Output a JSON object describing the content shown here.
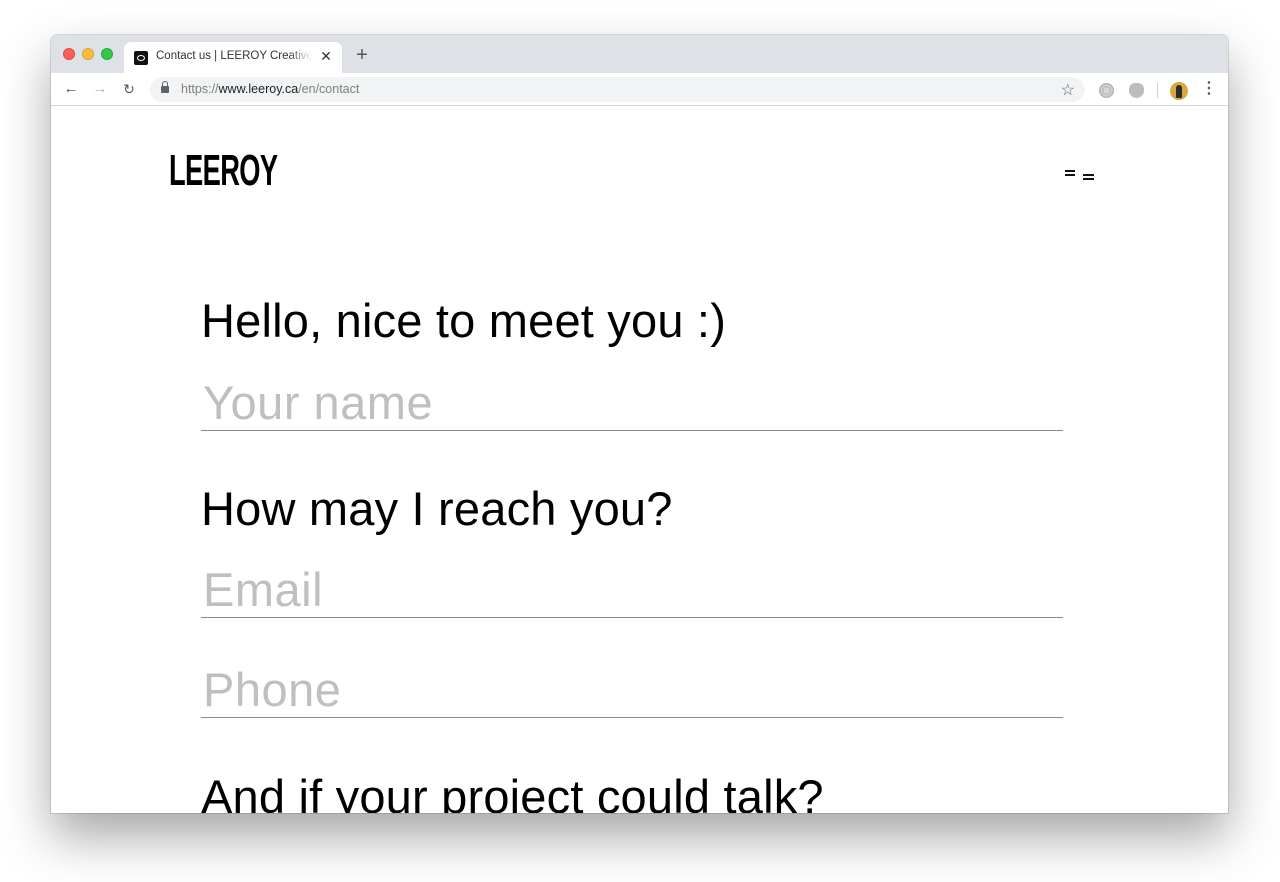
{
  "browser": {
    "tab": {
      "title": "Contact us | LEEROY Creative Agency",
      "close_glyph": "✕"
    },
    "new_tab_glyph": "+",
    "nav": {
      "back_glyph": "←",
      "forward_glyph": "→",
      "reload_glyph": "↻"
    },
    "url": {
      "scheme": "https://",
      "host": "www.leeroy.ca",
      "path": "/en/contact"
    },
    "star_glyph": "☆",
    "menu_glyph": "⋮"
  },
  "site": {
    "logo": "LEEROY"
  },
  "form": {
    "q1_heading": "Hello, nice to meet you :)",
    "name_placeholder": "Your name",
    "q2_heading": "How may I reach you?",
    "email_placeholder": "Email",
    "phone_placeholder": "Phone",
    "q3_heading": "And if your project could talk?"
  }
}
